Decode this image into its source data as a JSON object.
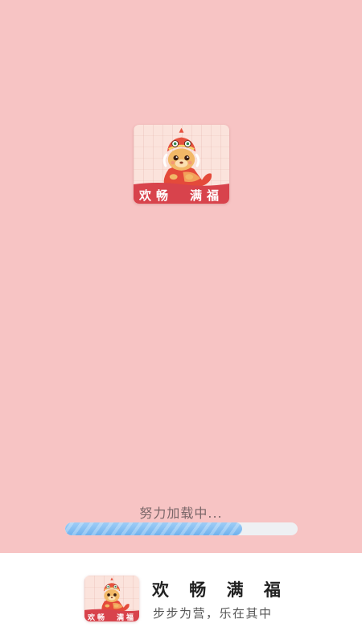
{
  "app": {
    "icon_banner_text": "欢畅　满福",
    "mascot_icon": "lion-dance-mascot-icon"
  },
  "loading": {
    "text": "努力加载中...",
    "progress": 0.76
  },
  "footer": {
    "app_name": "欢 畅 满 福",
    "slogan": "步步为营，乐在其中"
  },
  "colors": {
    "background": "#f7c4c4",
    "progress_fill": "#86c0f2",
    "progress_track": "#eef0f3",
    "banner_red": "#d8434c"
  }
}
